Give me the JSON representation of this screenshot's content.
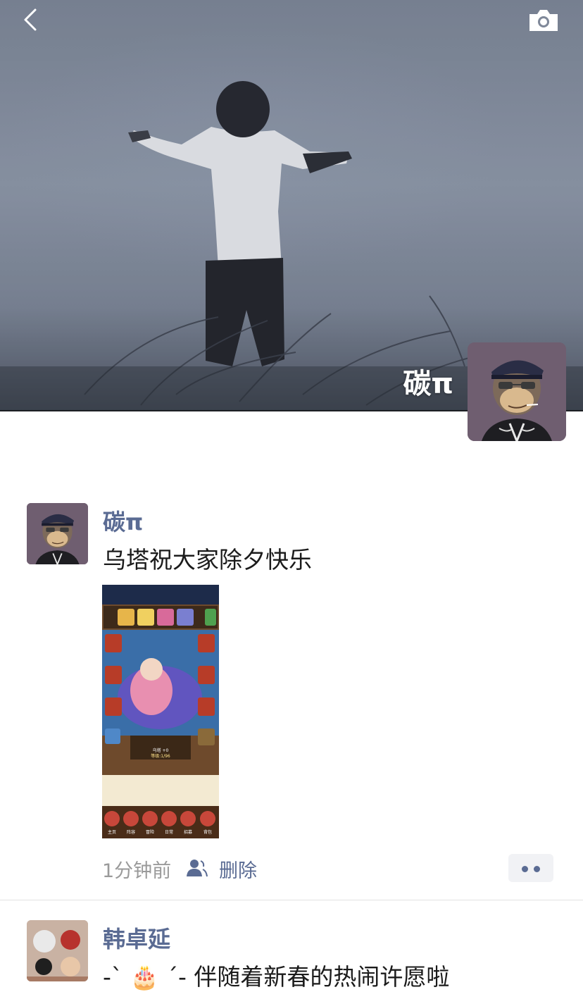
{
  "header": {
    "back_icon": "chevron-left-icon",
    "camera_icon": "camera-icon",
    "profile_name": "碳π"
  },
  "posts": [
    {
      "author": "碳π",
      "text": "乌塔祝大家除夕快乐",
      "time": "1分钟前",
      "visibility_icon": "people-icon",
      "delete_label": "删除",
      "more_icon": "more-dots-icon",
      "image_labels": {
        "char_name": "乌塔 +0",
        "level": "等级:1/96",
        "nav": [
          "主页",
          "阵容",
          "冒险",
          "日常",
          "招募",
          "背包"
        ]
      }
    },
    {
      "author": "韩卓延",
      "text": "-ˋ 🎂 ˊ- 伴随着新春的热闹许愿啦"
    }
  ],
  "colors": {
    "link": "#5a6b93",
    "text": "#1b1b1b",
    "meta": "#9a9a9a"
  }
}
